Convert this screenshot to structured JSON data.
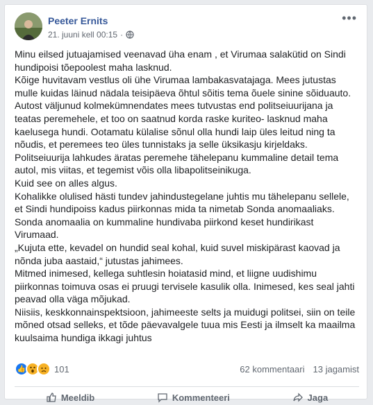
{
  "post": {
    "author": "Peeter Ernits",
    "timestamp": "21. juuni kell 00:15",
    "privacy_icon": "globe-icon",
    "more_icon": "ellipsis-icon",
    "paragraphs": [
      "Minu eilsed jutuajamised veenavad üha enam , et Virumaa salakütid on Sindi hundipoisi tõepoolest maha lasknud.",
      "Kõige huvitavam vestlus oli ühe Virumaa lambakasvatajaga. Mees jutustas mulle kuidas läinud nädala teisipäeva õhtul sõitis tema õuele sinine sõiduauto. Autost väljunud kolmekümnendates mees tutvustas end politseiuurijana ja teatas peremehele, et too on saatnud korda raske kuriteo- lasknud maha kaelusega hundi. Ootamatu külalise sõnul olla hundi laip üles leitud ning ta nõudis, et peremees teo üles tunnistaks ja selle üksikasju kirjeldaks. Politseiuurija lahkudes äratas peremehe tähelepanu kummaline detail tema autol, mis viitas, et tegemist võis olla libapolitseinikuga.",
      "Kuid see on alles algus.",
      "Kohalikke olulised hästi tundev jahindustegelane juhtis mu tähelepanu sellele, et Sindi hundipoiss kadus piirkonnas mida ta nimetab Sonda anomaaliaks.",
      "Sonda anomaalia on kummaline hundivaba piirkond keset hundirikast Virumaad.",
      "„Kujuta ette, kevadel on hundid seal kohal, kuid suvel miskipärast kaovad ja nõnda juba aastaid,“ jutustas jahimees.",
      "Mitmed inimesed, kellega suhtlesin hoiatasid mind, et liigne uudishimu piirkonnas toimuva osas ei pruugi tervisele kasulik olla. Inimesed, kes seal jahti peavad olla väga mõjukad.",
      "Niisiis, keskkonnainspektsioon, jahimeeste selts ja muidugi politsei, siin on teile mõned otsad selleks, et tõde päevavalgele tuua mis Eesti ja ilmselt ka maailma kuulsaima hundiga ikkagi juhtus"
    ]
  },
  "stats": {
    "reaction_icons": [
      "like-icon",
      "wow-icon",
      "sad-icon"
    ],
    "reaction_count": "101",
    "comments": "62 kommentaari",
    "shares": "13 jagamist"
  },
  "actions": {
    "like": "Meeldib",
    "comment": "Kommenteeri",
    "share": "Jaga"
  },
  "colors": {
    "author": "#365899",
    "like_blue": "#1877f2",
    "emoji_yellow": "#f7b125"
  }
}
